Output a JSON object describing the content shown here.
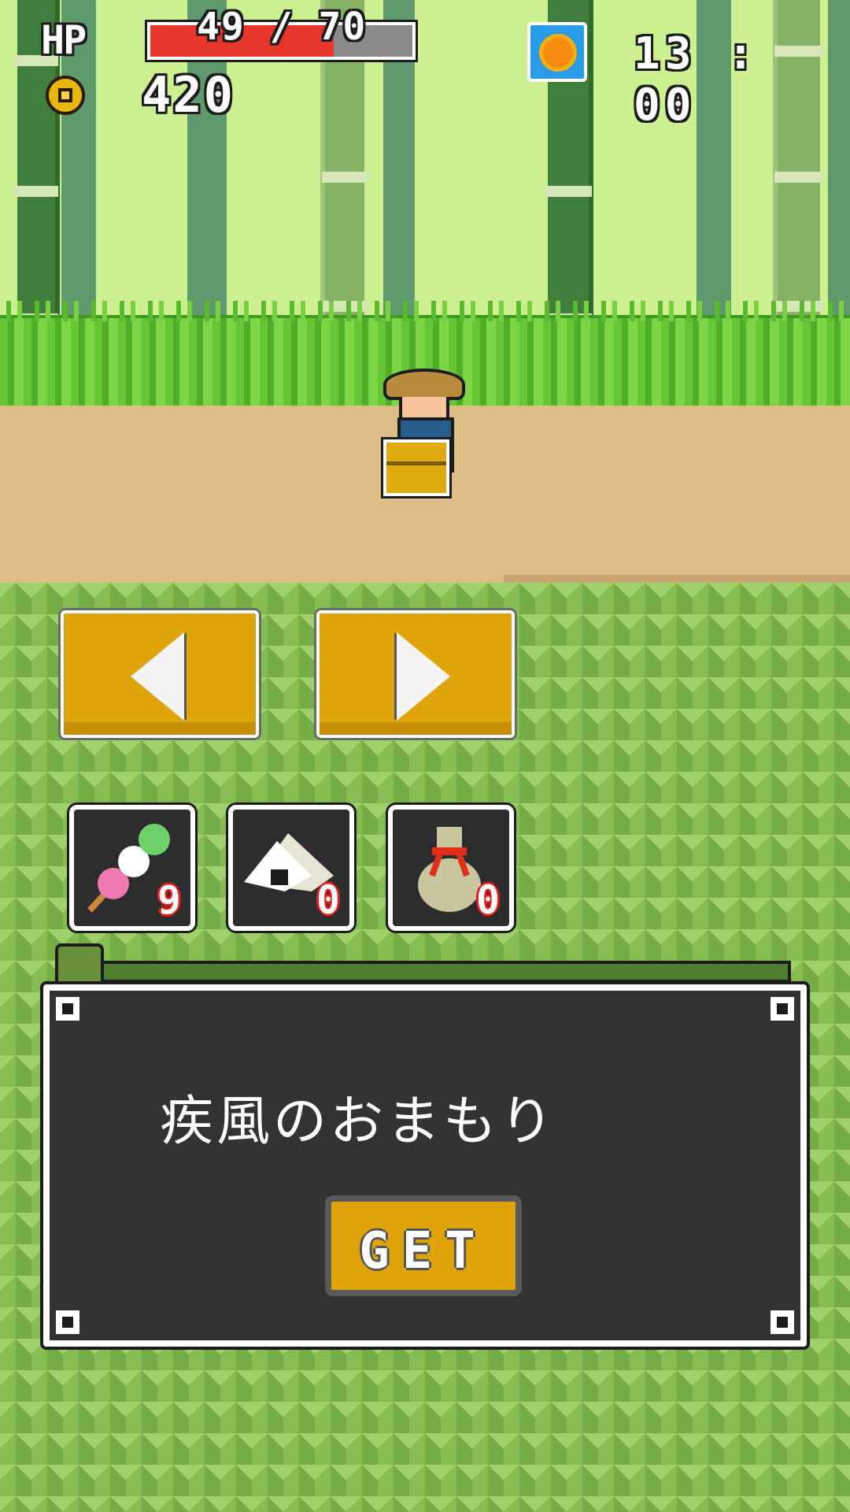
{
  "hud": {
    "hp_label": "HP",
    "hp_current": 49,
    "hp_max": 70,
    "hp_text": "49 / 70",
    "hp_fraction": 0.7,
    "gold": "420",
    "time": "13 : 00",
    "time_of_day_icon": "sun-icon"
  },
  "controls": {
    "left_icon": "left-arrow-icon",
    "right_icon": "right-arrow-icon"
  },
  "items": [
    {
      "name": "dango",
      "icon": "dango-icon",
      "count": "9"
    },
    {
      "name": "onigiri",
      "icon": "onigiri-icon",
      "count": "0"
    },
    {
      "name": "bag",
      "icon": "money-bag-icon",
      "count": "0"
    }
  ],
  "dialog": {
    "item_name": "疾風のおまもり",
    "get_label": "GET"
  },
  "colors": {
    "hp_fill": "#e7352b",
    "button": "#dfa508",
    "dialog_bg": "#333333"
  }
}
